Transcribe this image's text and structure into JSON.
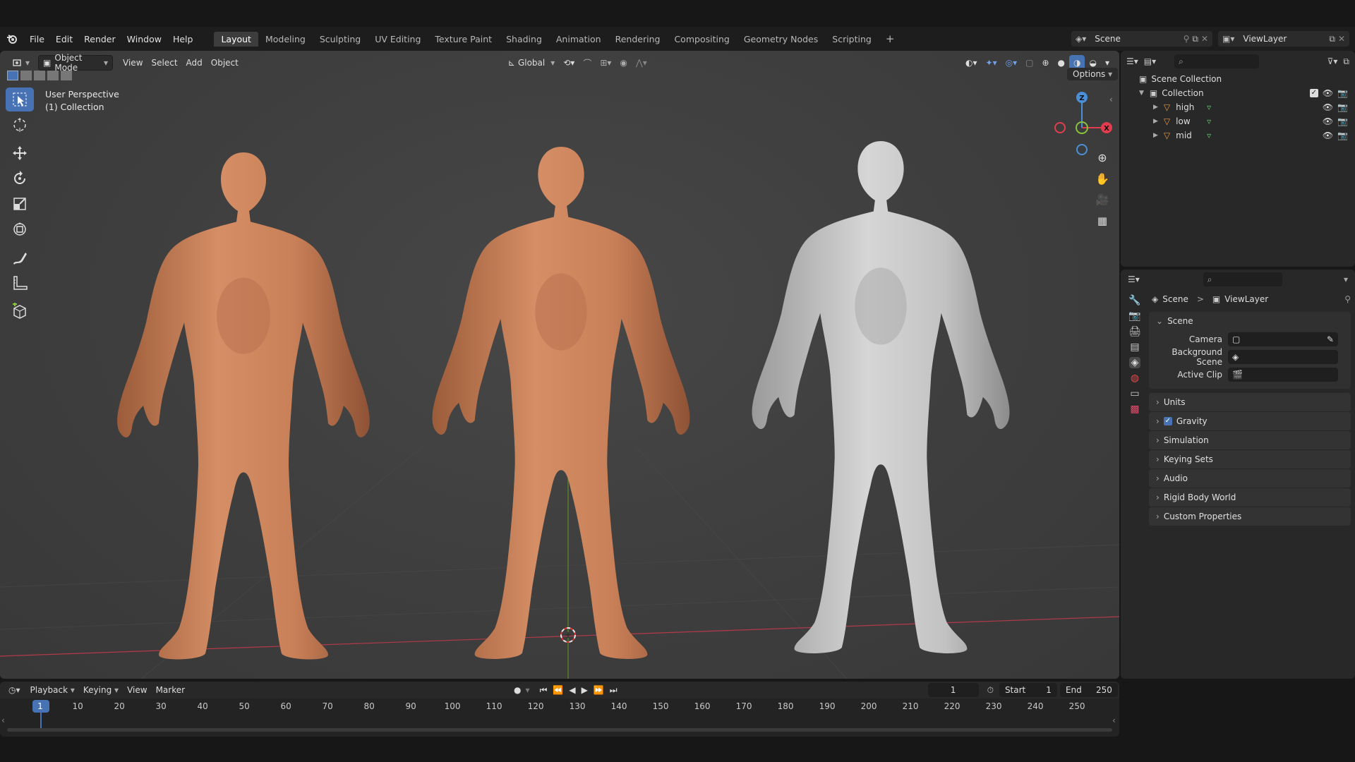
{
  "menubar": {
    "items": [
      "File",
      "Edit",
      "Render",
      "Window",
      "Help"
    ]
  },
  "workspaces": {
    "tabs": [
      "Layout",
      "Modeling",
      "Sculpting",
      "UV Editing",
      "Texture Paint",
      "Shading",
      "Animation",
      "Rendering",
      "Compositing",
      "Geometry Nodes",
      "Scripting"
    ],
    "add": "+",
    "active": "Layout"
  },
  "scene_selector": {
    "value": "Scene"
  },
  "viewlayer_selector": {
    "value": "ViewLayer"
  },
  "viewport": {
    "mode": "Object Mode",
    "menus": [
      "View",
      "Select",
      "Add",
      "Object"
    ],
    "orientation": "Global",
    "options": "Options",
    "overlay_title": "User Perspective",
    "overlay_collection": "(1) Collection",
    "gizmo": {
      "z": "Z",
      "x": "X"
    }
  },
  "outliner": {
    "root": "Scene Collection",
    "collection": "Collection",
    "objects": [
      {
        "name": "high"
      },
      {
        "name": "low"
      },
      {
        "name": "mid"
      }
    ]
  },
  "properties": {
    "breadcrumb_scene": "Scene",
    "breadcrumb_sep": ">",
    "breadcrumb_layer": "ViewLayer",
    "scene_section": "Scene",
    "camera_label": "Camera",
    "background_label": "Background Scene",
    "clip_label": "Active Clip",
    "sections": [
      "Units",
      "Gravity",
      "Simulation",
      "Keying Sets",
      "Audio",
      "Rigid Body World",
      "Custom Properties"
    ],
    "gravity_checked": true
  },
  "timeline": {
    "menus": [
      "Playback",
      "Keying",
      "View",
      "Marker"
    ],
    "current_frame": "1",
    "start_label": "Start",
    "start": "1",
    "end_label": "End",
    "end": "250",
    "ruler": [
      "1",
      "10",
      "20",
      "30",
      "40",
      "50",
      "60",
      "70",
      "80",
      "90",
      "100",
      "110",
      "120",
      "130",
      "140",
      "150",
      "160",
      "170",
      "180",
      "190",
      "200",
      "210",
      "220",
      "230",
      "240",
      "250"
    ]
  },
  "colors": {
    "accent": "#4772b3",
    "skin": "#c98058",
    "clay": "#c4c4c4",
    "axis_x": "#e23d4e",
    "axis_y": "#8ac43b",
    "axis_z": "#4a8fd8"
  }
}
